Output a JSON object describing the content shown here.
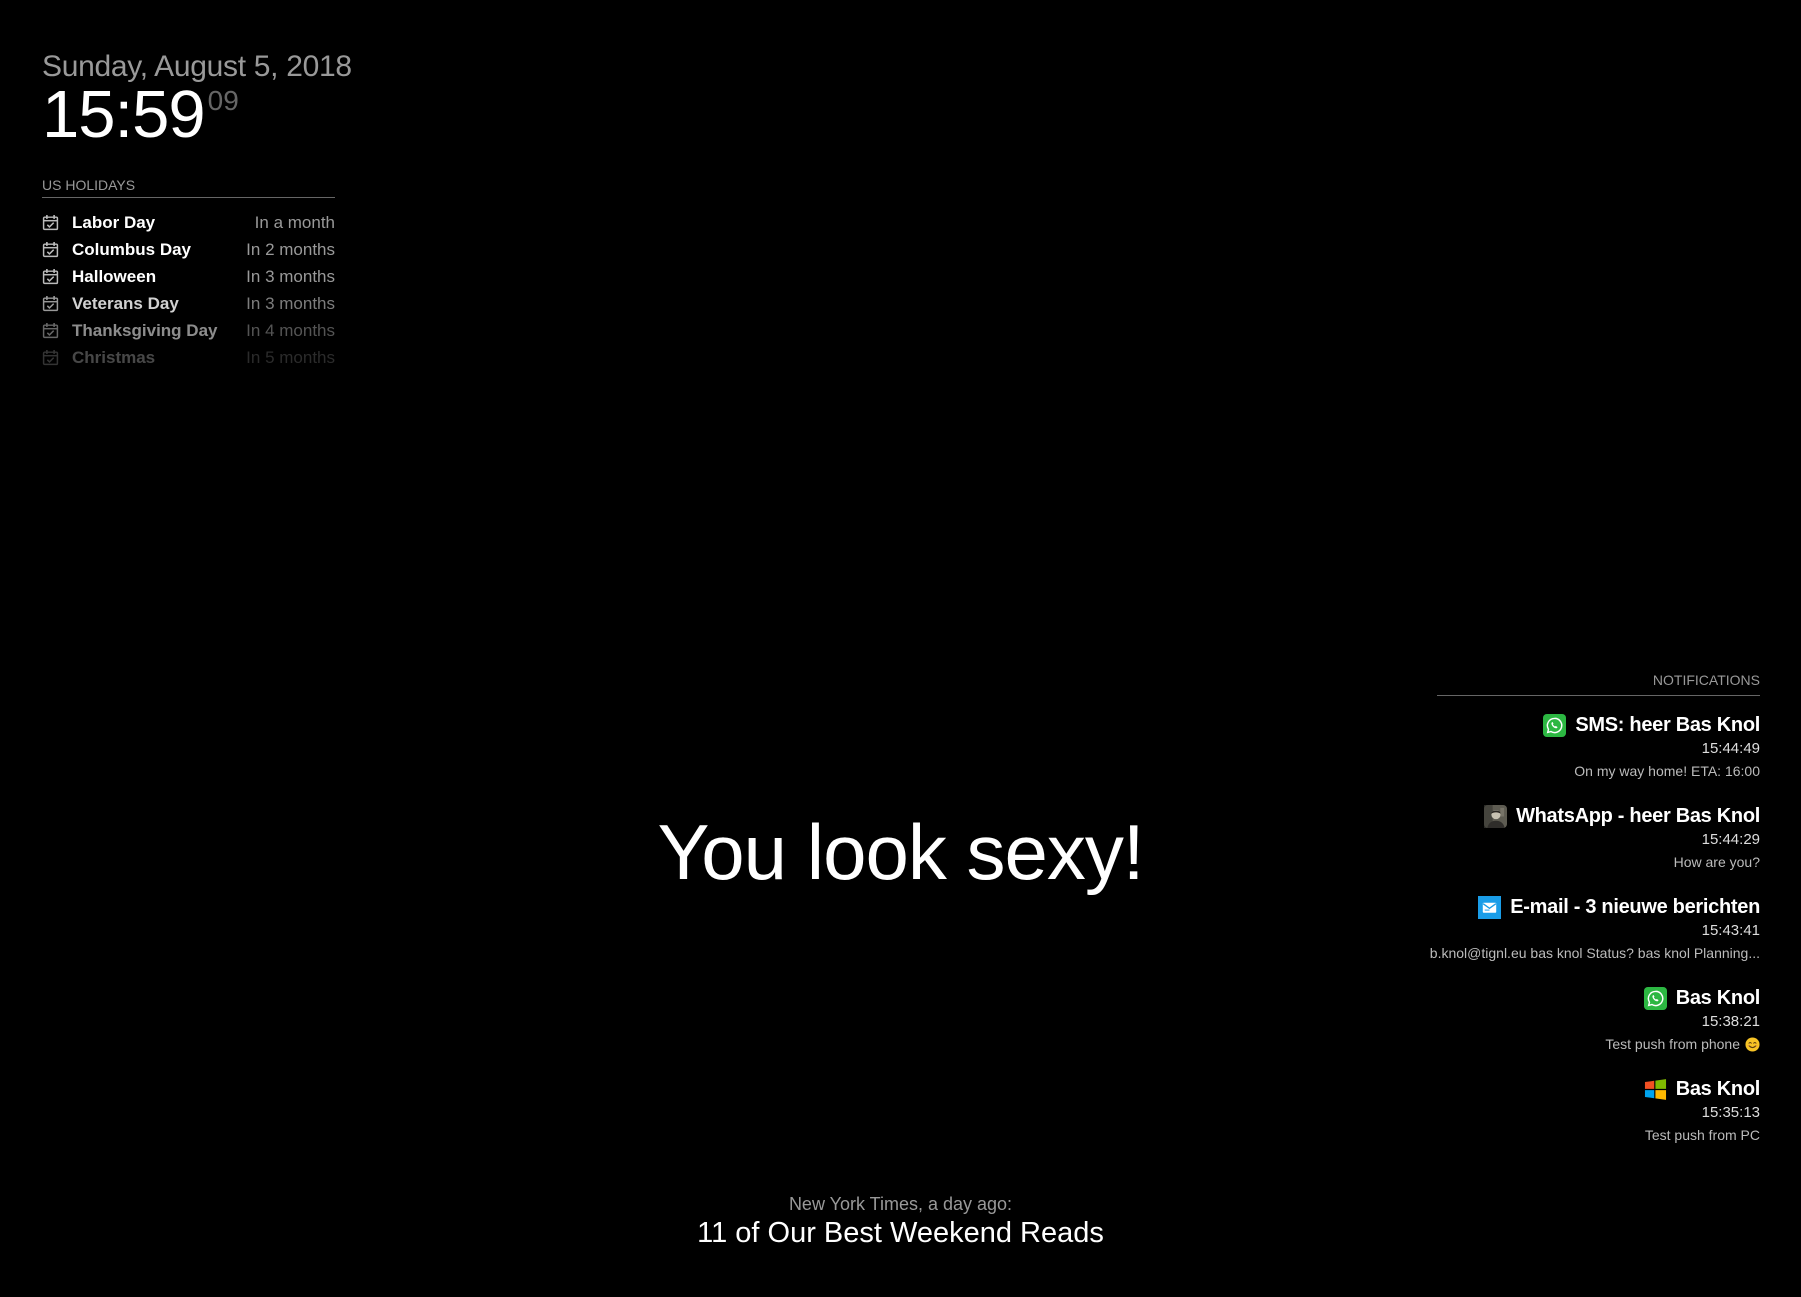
{
  "clock": {
    "date": "Sunday, August 5, 2018",
    "time": "15:59",
    "seconds": "09"
  },
  "calendar": {
    "header": "US HOLIDAYS",
    "events": [
      {
        "title": "Labor Day",
        "relative": "In a month",
        "icon": "calendar-check-icon"
      },
      {
        "title": "Columbus Day",
        "relative": "In 2 months",
        "icon": "calendar-check-icon"
      },
      {
        "title": "Halloween",
        "relative": "In 3 months",
        "icon": "calendar-check-icon"
      },
      {
        "title": "Veterans Day",
        "relative": "In 3 months",
        "icon": "calendar-check-icon"
      },
      {
        "title": "Thanksgiving Day",
        "relative": "In 4 months",
        "icon": "calendar-check-icon"
      },
      {
        "title": "Christmas",
        "relative": "In 5 months",
        "icon": "calendar-check-icon"
      }
    ]
  },
  "compliment": {
    "text": "You look sexy!"
  },
  "notifications": {
    "header": "NOTIFICATIONS",
    "items": [
      {
        "icon": "whatsapp-icon",
        "title": "SMS: heer Bas Knol",
        "time": "15:44:49",
        "body": "On my way home! ETA: 16:00"
      },
      {
        "icon": "contact-avatar-icon",
        "title": "WhatsApp - heer Bas Knol",
        "time": "15:44:29",
        "body": "How are you?"
      },
      {
        "icon": "email-icon",
        "title": "E-mail - 3 nieuwe berichten",
        "time": "15:43:41",
        "body": "b.knol@tignl.eu bas knol Status? bas knol Planning..."
      },
      {
        "icon": "whatsapp-icon",
        "title": "Bas Knol",
        "time": "15:38:21",
        "body": "Test push from phone",
        "trailing_icon": "smiling-face-icon"
      },
      {
        "icon": "windows-icon",
        "title": "Bas Knol",
        "time": "15:35:13",
        "body": "Test push from PC"
      }
    ]
  },
  "newsfeed": {
    "source": "New York Times, a day ago:",
    "headline": "11 of Our Best Weekend Reads"
  },
  "colors": {
    "background": "#000000",
    "text": "#ffffff",
    "dimmed": "#999999",
    "faint": "#666666",
    "whatsapp_green": "#2cb742",
    "email_blue": "#1a9de8"
  }
}
